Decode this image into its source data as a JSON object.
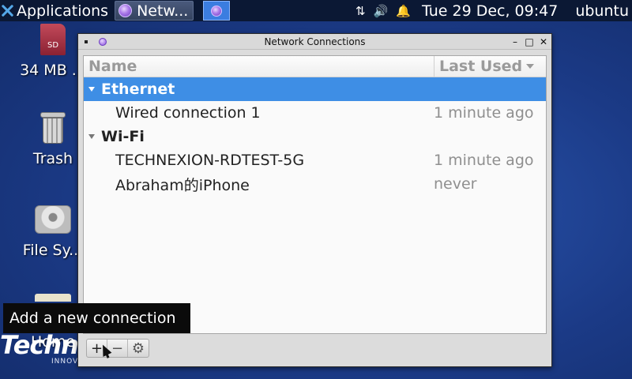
{
  "panel": {
    "applications_label": "Applications",
    "task_title": "Netw...",
    "clock": "Tue 29 Dec, 09:47",
    "user": "ubuntu",
    "tray_icons": [
      "network-arrows-icon",
      "volume-icon",
      "notification-bell-icon"
    ]
  },
  "desktop": {
    "items": [
      {
        "label": "34 MB ...",
        "icon": "sd-card-icon"
      },
      {
        "label": "Trash",
        "icon": "trash-icon"
      },
      {
        "label": "File Sy...",
        "icon": "hard-disk-icon"
      },
      {
        "label": "Home",
        "icon": "folder-icon"
      }
    ],
    "logo_text": "Techn",
    "logo_subtext": "INNOVA"
  },
  "window": {
    "title": "Network Connections",
    "controls": {
      "minimize": "–",
      "maximize": "□",
      "close": "✕"
    },
    "columns": {
      "name": "Name",
      "last_used": "Last Used"
    },
    "groups": [
      {
        "label": "Ethernet",
        "selected": true,
        "connections": [
          {
            "name": "Wired connection 1",
            "last_used": "1 minute ago"
          }
        ]
      },
      {
        "label": "Wi-Fi",
        "selected": false,
        "connections": [
          {
            "name": "TECHNEXION-RDTEST-5G",
            "last_used": "1 minute ago"
          },
          {
            "name": "Abraham的iPhone",
            "last_used": "never"
          }
        ]
      }
    ],
    "toolbar": {
      "add": "+",
      "remove": "−",
      "settings": "⚙"
    }
  },
  "tooltip": {
    "text": "Add a new connection"
  },
  "colors": {
    "selection": "#3e8ee5",
    "panel": "#0b1834",
    "desktop": "#1d3d8a"
  }
}
